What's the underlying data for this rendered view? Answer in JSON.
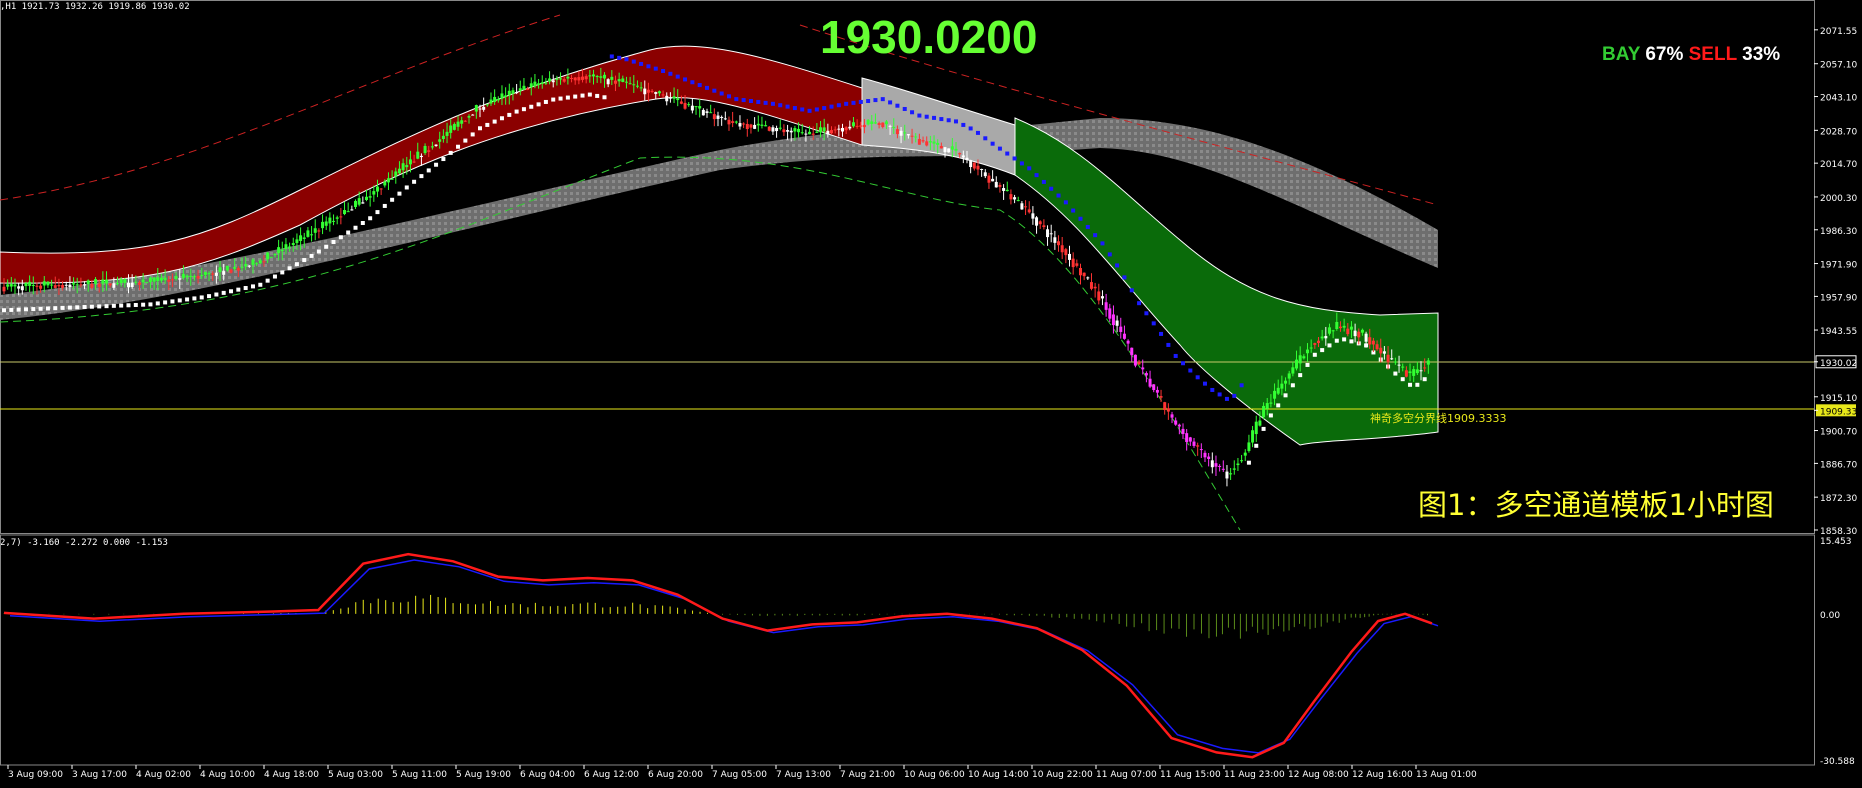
{
  "header": {
    "symbol_info": ",H1  1921.73 1932.26 1919.86 1930.02",
    "indicator_info": "2,7) -3.160 -2.272 0.000 -1.153"
  },
  "overlay": {
    "big_price": "1930.0200",
    "bay_label": "BAY",
    "bay_pct": "67%",
    "sell_label": "SELL",
    "sell_pct": "33%",
    "divider_label": "神奇多空分界线1909.3333",
    "caption": "图1：多空通道模板1小时图"
  },
  "colors": {
    "background": "#000000",
    "bull_channel": "#8b0000",
    "bear_channel": "#0a6b0a",
    "neutral_channel": "#a9a9a9",
    "gray_band": "#707070",
    "blue_dots": "#1a1aff",
    "white_dots": "#ffffff",
    "macd_line": "#ff1a1a",
    "signal_line": "#1a1aff",
    "histogram": "#e8e81a",
    "price_line": "#e8e81a",
    "axis_text": "#ffffff"
  },
  "chart_data": {
    "type": "candlestick",
    "timeframe": "H1",
    "price_axis": {
      "ylim": [
        1858.3,
        2080
      ],
      "ticks": [
        "2071.55",
        "2057.10",
        "2043.10",
        "2028.70",
        "2014.70",
        "2000.30",
        "1986.30",
        "1971.90",
        "1957.90",
        "1943.55",
        "1930.02",
        "1915.10",
        "1909.33",
        "1900.70",
        "1886.70",
        "1872.30",
        "1858.30"
      ],
      "current_price": "1930.02",
      "divider_price": "1909.33"
    },
    "indicator_axis": {
      "ylim": [
        -30.588,
        15.453
      ],
      "ticks": [
        "15.453",
        "0.00",
        "-30.588"
      ]
    },
    "time_axis": {
      "labels": [
        "3 Aug 09:00",
        "3 Aug 17:00",
        "4 Aug 02:00",
        "4 Aug 10:00",
        "4 Aug 18:00",
        "5 Aug 03:00",
        "5 Aug 11:00",
        "5 Aug 19:00",
        "6 Aug 04:00",
        "6 Aug 12:00",
        "6 Aug 20:00",
        "7 Aug 05:00",
        "7 Aug 13:00",
        "7 Aug 21:00",
        "10 Aug 06:00",
        "10 Aug 14:00",
        "10 Aug 22:00",
        "11 Aug 07:00",
        "11 Aug 15:00",
        "11 Aug 23:00",
        "12 Aug 08:00",
        "12 Aug 16:00",
        "13 Aug 01:00"
      ]
    },
    "price_path": [
      [
        0,
        1962
      ],
      [
        20,
        1963
      ],
      [
        40,
        1964
      ],
      [
        55,
        1967
      ],
      [
        70,
        1972
      ],
      [
        85,
        1985
      ],
      [
        100,
        2000
      ],
      [
        110,
        2013
      ],
      [
        120,
        2025
      ],
      [
        130,
        2038
      ],
      [
        140,
        2045
      ],
      [
        150,
        2050
      ],
      [
        160,
        2052
      ],
      [
        170,
        2049
      ],
      [
        180,
        2044
      ],
      [
        190,
        2038
      ],
      [
        200,
        2032
      ],
      [
        210,
        2030
      ],
      [
        220,
        2027
      ],
      [
        230,
        2030
      ],
      [
        240,
        2032
      ],
      [
        250,
        2025
      ],
      [
        260,
        2020
      ],
      [
        265,
        2015
      ],
      [
        270,
        2008
      ],
      [
        280,
        1995
      ],
      [
        290,
        1978
      ],
      [
        300,
        1958
      ],
      [
        305,
        1945
      ],
      [
        310,
        1930
      ],
      [
        315,
        1918
      ],
      [
        320,
        1905
      ],
      [
        325,
        1896
      ],
      [
        330,
        1888
      ],
      [
        335,
        1882
      ],
      [
        340,
        1892
      ],
      [
        345,
        1910
      ],
      [
        352,
        1925
      ],
      [
        358,
        1938
      ],
      [
        365,
        1945
      ],
      [
        372,
        1942
      ],
      [
        380,
        1930
      ],
      [
        385,
        1924
      ],
      [
        390,
        1930
      ]
    ],
    "macd_path": [
      [
        0,
        0.2
      ],
      [
        20,
        -1.0
      ],
      [
        40,
        0.0
      ],
      [
        60,
        0.5
      ],
      [
        70,
        0.8
      ],
      [
        80,
        10.5
      ],
      [
        90,
        12.5
      ],
      [
        100,
        11.0
      ],
      [
        110,
        7.8
      ],
      [
        120,
        7.0
      ],
      [
        130,
        7.5
      ],
      [
        140,
        7.0
      ],
      [
        150,
        4.0
      ],
      [
        160,
        -1.0
      ],
      [
        170,
        -3.5
      ],
      [
        180,
        -2.2
      ],
      [
        190,
        -1.8
      ],
      [
        200,
        -0.5
      ],
      [
        210,
        0.0
      ],
      [
        220,
        -1.0
      ],
      [
        230,
        -3.0
      ],
      [
        240,
        -7.5
      ],
      [
        250,
        -15.0
      ],
      [
        260,
        -26.0
      ],
      [
        270,
        -29.0
      ],
      [
        278,
        -30.0
      ],
      [
        285,
        -27.0
      ],
      [
        292,
        -18.0
      ],
      [
        300,
        -8.0
      ],
      [
        306,
        -1.5
      ],
      [
        312,
        0.0
      ],
      [
        318,
        -2.0
      ]
    ]
  }
}
